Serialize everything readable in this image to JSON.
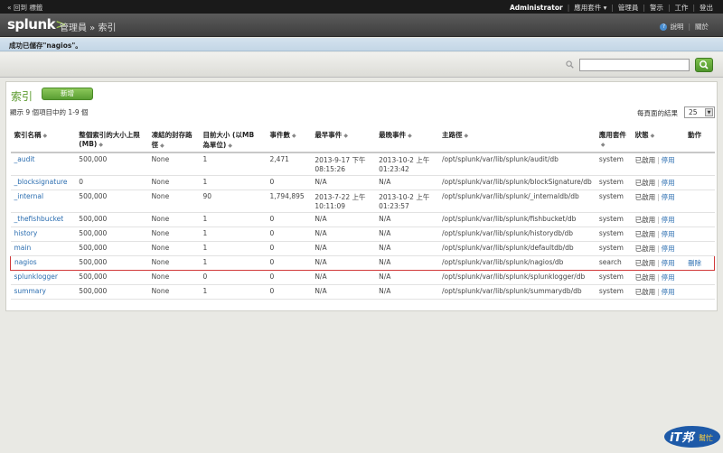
{
  "topbar": {
    "back": "« 回到 標籤",
    "admin": "Administrator",
    "apps": "應用套件 ▾",
    "manager": "管理員",
    "alerts": "警示",
    "jobs": "工作",
    "logout": "登出"
  },
  "header": {
    "logo": "splunk",
    "logo_mark": ">",
    "breadcrumb": "管理員 » 索引",
    "help": "說明",
    "about": "關於"
  },
  "notice": "成功已儲存\"nagios\"。",
  "search": {
    "value": ""
  },
  "main": {
    "title": "索引",
    "new_button": "新增",
    "count_text": "顯示 9 個項目中的 1-9 個",
    "per_page_label": "每頁面的結果",
    "per_page_value": "25"
  },
  "table": {
    "headers": [
      "索引名稱",
      "整個索引的大小上限 (MB)",
      "凍結的封存路徑",
      "目前大小 (以MB 為單位)",
      "事件數",
      "最早事件",
      "最晚事件",
      "主路徑",
      "應用套件",
      "狀態",
      "動作"
    ],
    "rows": [
      {
        "name": "_audit",
        "max": "500,000",
        "frozen": "None",
        "size": "1",
        "events": "2,471",
        "earliest": "2013-9-17 下午 08:15:26",
        "latest": "2013-10-2 上午 01:23:42",
        "path": "/opt/splunk/var/lib/splunk/audit/db",
        "app": "system",
        "enabled": "已啟用",
        "disable": "停用",
        "action": ""
      },
      {
        "name": "_blocksignature",
        "max": "0",
        "frozen": "None",
        "size": "1",
        "events": "0",
        "earliest": "N/A",
        "latest": "N/A",
        "path": "/opt/splunk/var/lib/splunk/blockSignature/db",
        "app": "system",
        "enabled": "已啟用",
        "disable": "停用",
        "action": ""
      },
      {
        "name": "_internal",
        "max": "500,000",
        "frozen": "None",
        "size": "90",
        "events": "1,794,895",
        "earliest": "2013-7-22 上午 10:11:09",
        "latest": "2013-10-2 上午 01:23:57",
        "path": "/opt/splunk/var/lib/splunk/_internaldb/db",
        "app": "system",
        "enabled": "已啟用",
        "disable": "停用",
        "action": ""
      },
      {
        "name": "_thefishbucket",
        "max": "500,000",
        "frozen": "None",
        "size": "1",
        "events": "0",
        "earliest": "N/A",
        "latest": "N/A",
        "path": "/opt/splunk/var/lib/splunk/fishbucket/db",
        "app": "system",
        "enabled": "已啟用",
        "disable": "停用",
        "action": ""
      },
      {
        "name": "history",
        "max": "500,000",
        "frozen": "None",
        "size": "1",
        "events": "0",
        "earliest": "N/A",
        "latest": "N/A",
        "path": "/opt/splunk/var/lib/splunk/historydb/db",
        "app": "system",
        "enabled": "已啟用",
        "disable": "停用",
        "action": ""
      },
      {
        "name": "main",
        "max": "500,000",
        "frozen": "None",
        "size": "1",
        "events": "0",
        "earliest": "N/A",
        "latest": "N/A",
        "path": "/opt/splunk/var/lib/splunk/defaultdb/db",
        "app": "system",
        "enabled": "已啟用",
        "disable": "停用",
        "action": ""
      },
      {
        "name": "nagios",
        "max": "500,000",
        "frozen": "None",
        "size": "1",
        "events": "0",
        "earliest": "N/A",
        "latest": "N/A",
        "path": "/opt/splunk/var/lib/splunk/nagios/db",
        "app": "search",
        "enabled": "已啟用",
        "disable": "停用",
        "action": "刪除"
      },
      {
        "name": "splunklogger",
        "max": "500,000",
        "frozen": "None",
        "size": "0",
        "events": "0",
        "earliest": "N/A",
        "latest": "N/A",
        "path": "/opt/splunk/var/lib/splunk/splunklogger/db",
        "app": "system",
        "enabled": "已啟用",
        "disable": "停用",
        "action": ""
      },
      {
        "name": "summary",
        "max": "500,000",
        "frozen": "None",
        "size": "1",
        "events": "0",
        "earliest": "N/A",
        "latest": "N/A",
        "path": "/opt/splunk/var/lib/splunk/summarydb/db",
        "app": "system",
        "enabled": "已啟用",
        "disable": "停用",
        "action": ""
      }
    ]
  },
  "watermark": {
    "brand": "iT邦",
    "sub": "幫忙"
  }
}
